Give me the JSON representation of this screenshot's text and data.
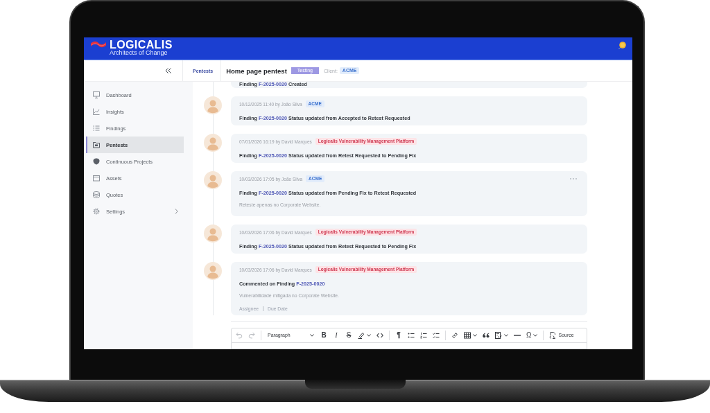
{
  "top_bar": {
    "brand": "LOGICALIS",
    "tagline": "Architects of Change"
  },
  "page_header": {
    "breadcrumb": "Pentests",
    "title": "Home page pentest",
    "status": "Testing",
    "client_label": "Client:",
    "client": "ACME"
  },
  "sidebar": {
    "items": [
      {
        "label": "Dashboard",
        "selected": false,
        "expandable": false
      },
      {
        "label": "Insights",
        "selected": false,
        "expandable": false
      },
      {
        "label": "Findings",
        "selected": false,
        "expandable": false
      },
      {
        "label": "Pentests",
        "selected": true,
        "expandable": false
      },
      {
        "label": "Continuous Projects",
        "selected": false,
        "expandable": false
      },
      {
        "label": "Assets",
        "selected": false,
        "expandable": false
      },
      {
        "label": "Quotes",
        "selected": false,
        "expandable": false
      },
      {
        "label": "Settings",
        "selected": false,
        "expandable": true
      }
    ]
  },
  "activity": [
    {
      "action": {
        "text": "Finding",
        "finding": "F-2025-0020",
        "rest": "Created"
      },
      "hovered": false
    },
    {
      "timestamp": "10/12/2025 11:40 by João Silva",
      "tag": {
        "label": "ACME",
        "kind": "client"
      },
      "action": {
        "text": "Finding",
        "finding": "F-2025-0020",
        "rest": "Status updated from Accepted to Retest Requested"
      },
      "hovered": false
    },
    {
      "timestamp": "07/01/2026 16:19 by David Marques",
      "tag": {
        "label": "Logicalis Vulnerability Management Platform",
        "kind": "platform"
      },
      "action": {
        "text": "Finding",
        "finding": "F-2025-0020",
        "rest": "Status updated from Retest Requested to Pending Fix"
      },
      "hovered": false
    },
    {
      "timestamp": "10/03/2026 17:05 by João Silva",
      "tag": {
        "label": "ACME",
        "kind": "client"
      },
      "action": {
        "text": "Finding",
        "finding": "F-2025-0020",
        "rest": "Status updated from Pending Fix to Retest Requested"
      },
      "comment": "Reteste apenas no Corporate Website.",
      "hovered": true
    },
    {
      "timestamp": "10/03/2026 17:06 by David Marques",
      "tag": {
        "label": "Logicalis Vulnerability Management Platform",
        "kind": "platform"
      },
      "action": {
        "text": "Finding",
        "finding": "F-2025-0020",
        "rest": "Status updated from Retest Requested to Pending Fix"
      },
      "hovered": false
    },
    {
      "timestamp": "10/03/2026 17:06 by David Marques",
      "tag": {
        "label": "Logicalis Vulnerability Management Platform",
        "kind": "platform"
      },
      "action": {
        "text": "Commented on Finding",
        "finding": "F-2025-0020"
      },
      "comment": "Vulnerabilidade mitigada no Corporate Website.",
      "links": [
        "Assignee",
        "Due Date"
      ],
      "hovered": false
    }
  ],
  "editor": {
    "toolbar": [
      [
        {
          "kind": "undo",
          "disabled": true,
          "dropdown": false
        },
        {
          "kind": "redo",
          "disabled": true,
          "dropdown": false
        }
      ],
      [
        {
          "kind": "heading",
          "label": "Paragraph",
          "disabled": false,
          "dropdown": true
        },
        {
          "kind": "bold",
          "label": "B",
          "disabled": false,
          "dropdown": false
        },
        {
          "kind": "italic",
          "label": "I",
          "disabled": false,
          "dropdown": false
        },
        {
          "kind": "strike",
          "label": "S",
          "disabled": false,
          "dropdown": false
        },
        {
          "kind": "highlight",
          "disabled": false,
          "dropdown": true
        },
        {
          "kind": "code",
          "disabled": false,
          "dropdown": false
        }
      ],
      [
        {
          "kind": "pilcrow",
          "label": "¶",
          "disabled": false,
          "dropdown": false
        },
        {
          "kind": "bullets",
          "disabled": false,
          "dropdown": false
        },
        {
          "kind": "numbers",
          "disabled": false,
          "dropdown": false
        },
        {
          "kind": "todo",
          "disabled": false,
          "dropdown": false
        }
      ],
      [
        {
          "kind": "link",
          "disabled": false,
          "dropdown": false
        },
        {
          "kind": "table",
          "disabled": false,
          "dropdown": true
        },
        {
          "kind": "quote",
          "disabled": false,
          "dropdown": false
        },
        {
          "kind": "media",
          "disabled": false,
          "dropdown": true
        },
        {
          "kind": "rule",
          "disabled": false,
          "dropdown": false
        },
        {
          "kind": "symbols",
          "label": "Ω",
          "disabled": false,
          "dropdown": true
        }
      ],
      [
        {
          "kind": "source",
          "label": "Source",
          "disabled": false,
          "dropdown": false
        }
      ]
    ]
  }
}
